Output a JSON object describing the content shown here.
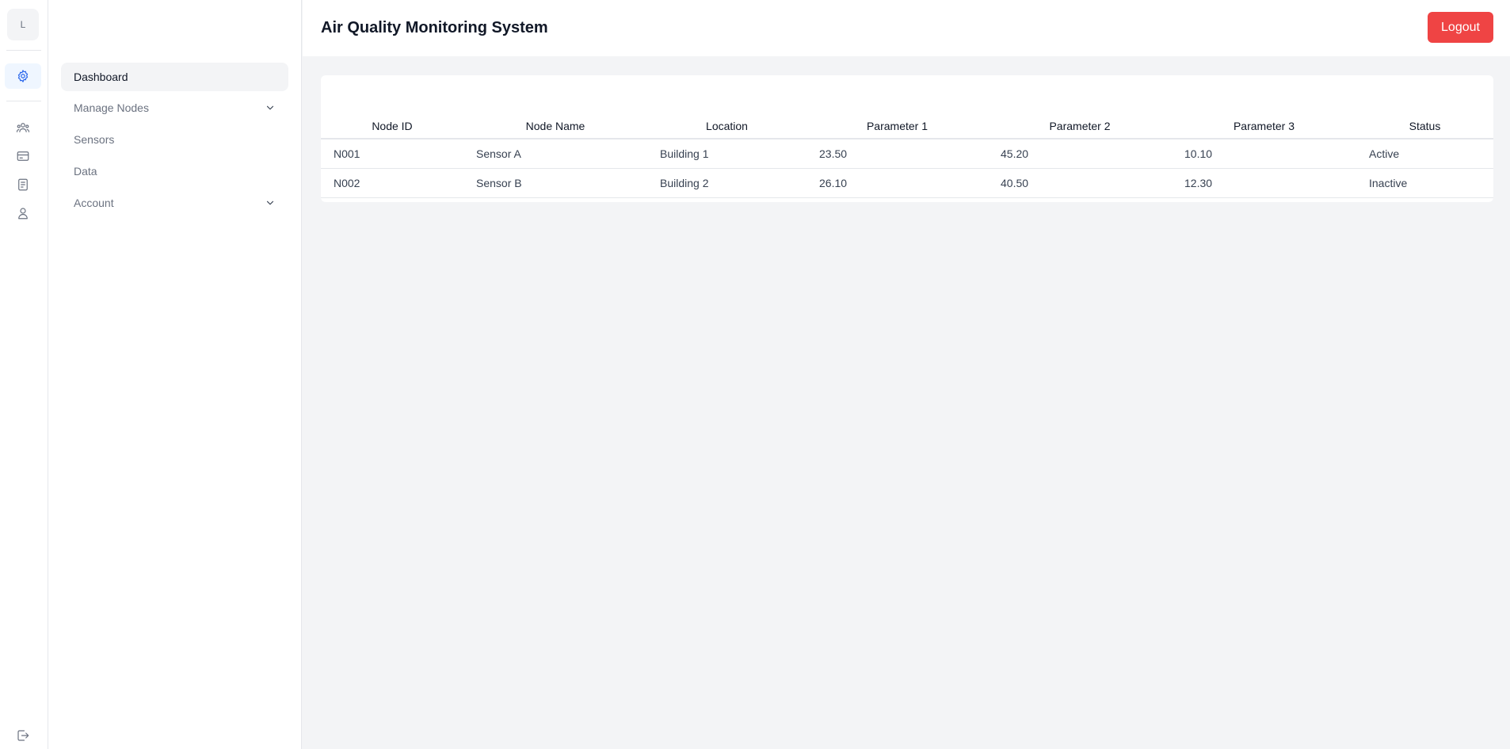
{
  "rail": {
    "logo_letter": "L",
    "icons": [
      "settings-icon",
      "users-icon",
      "card-icon",
      "document-icon",
      "user-icon",
      "logout-icon"
    ],
    "active_color": "#2563eb"
  },
  "nav": {
    "items": [
      {
        "label": "Dashboard",
        "active": true,
        "expandable": false
      },
      {
        "label": "Manage Nodes",
        "active": false,
        "expandable": true
      },
      {
        "label": "Sensors",
        "active": false,
        "expandable": false
      },
      {
        "label": "Data",
        "active": false,
        "expandable": false
      },
      {
        "label": "Account",
        "active": false,
        "expandable": true
      }
    ]
  },
  "header": {
    "title": "Air Quality Monitoring System",
    "logout_label": "Logout",
    "logout_color": "#ef4444"
  },
  "table": {
    "columns": [
      "Node ID",
      "Node Name",
      "Location",
      "Parameter 1",
      "Parameter 2",
      "Parameter 3",
      "Status"
    ],
    "rows": [
      [
        "N001",
        "Sensor A",
        "Building 1",
        "23.50",
        "45.20",
        "10.10",
        "Active"
      ],
      [
        "N002",
        "Sensor B",
        "Building 2",
        "26.10",
        "40.50",
        "12.30",
        "Inactive"
      ]
    ]
  }
}
